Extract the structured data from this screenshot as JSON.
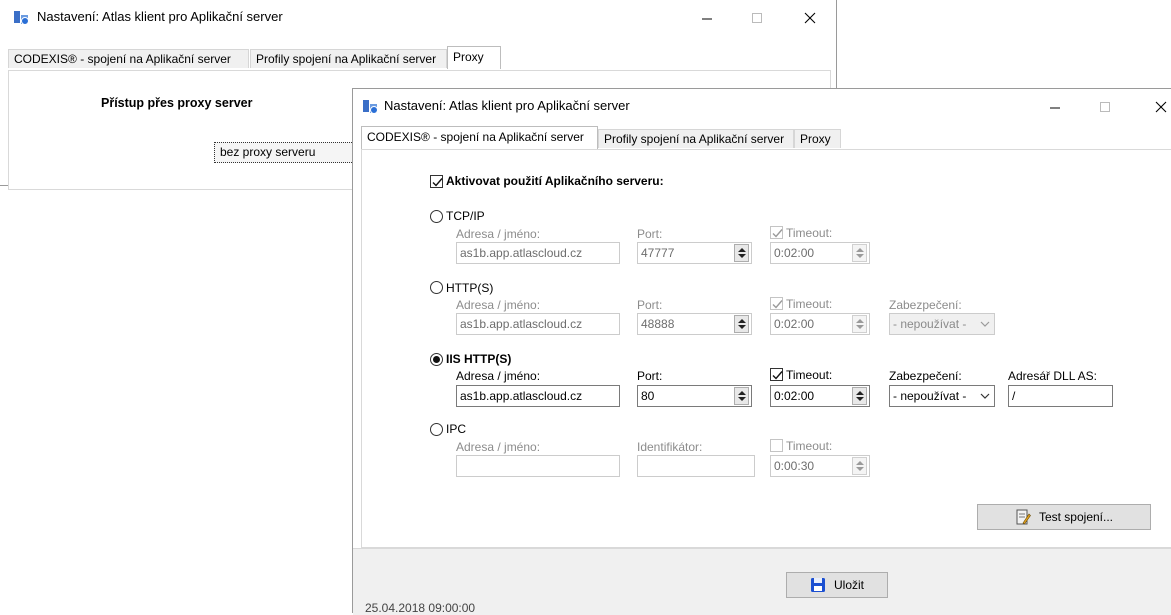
{
  "back_window": {
    "title": "Nastavení: Atlas klient pro Aplikační server",
    "tabs": [
      "CODEXIS® - spojení na Aplikační server",
      "Profily spojení na Aplikační server",
      "Proxy"
    ],
    "active_tab": 2,
    "proxy_heading": "Přístup přes proxy server",
    "proxy_mode": "bez proxy serveru"
  },
  "front_window": {
    "title": "Nastavení: Atlas klient pro Aplikační server",
    "tabs": [
      "CODEXIS® - spojení na Aplikační server",
      "Profily spojení na Aplikační server",
      "Proxy"
    ],
    "active_tab": 0,
    "activate_label": "Aktivovat použití Aplikačního serveru:",
    "activate_checked": true,
    "sections": {
      "tcpip": {
        "label": "TCP/IP",
        "selected": false,
        "address_label": "Adresa / jméno:",
        "address": "as1b.app.atlascloud.cz",
        "port_label": "Port:",
        "port": "47777",
        "timeout_label": "Timeout:",
        "timeout_checked": true,
        "timeout": "0:02:00"
      },
      "https": {
        "label": "HTTP(S)",
        "selected": false,
        "address_label": "Adresa / jméno:",
        "address": "as1b.app.atlascloud.cz",
        "port_label": "Port:",
        "port": "48888",
        "timeout_label": "Timeout:",
        "timeout_checked": true,
        "timeout": "0:02:00",
        "security_label": "Zabezpečení:",
        "security": "- nepoužívat -"
      },
      "iis": {
        "label": "IIS HTTP(S)",
        "selected": true,
        "address_label": "Adresa / jméno:",
        "address": "as1b.app.atlascloud.cz",
        "port_label": "Port:",
        "port": "80",
        "timeout_label": "Timeout:",
        "timeout_checked": true,
        "timeout": "0:02:00",
        "security_label": "Zabezpečení:",
        "security": "- nepoužívat -",
        "dll_label": "Adresář DLL AS:",
        "dll": "/"
      },
      "ipc": {
        "label": "IPC",
        "selected": false,
        "address_label": "Adresa / jméno:",
        "address": "",
        "id_label": "Identifikátor:",
        "id": "",
        "timeout_label": "Timeout:",
        "timeout_checked": false,
        "timeout": "0:00:30"
      }
    },
    "test_button": "Test spojení...",
    "save_button": "Uložit",
    "status_timestamp": "25.04.2018 09:00:00"
  },
  "colors": {
    "save_icon": "#1b4fd1",
    "app_icon": "#2a6fd6"
  }
}
